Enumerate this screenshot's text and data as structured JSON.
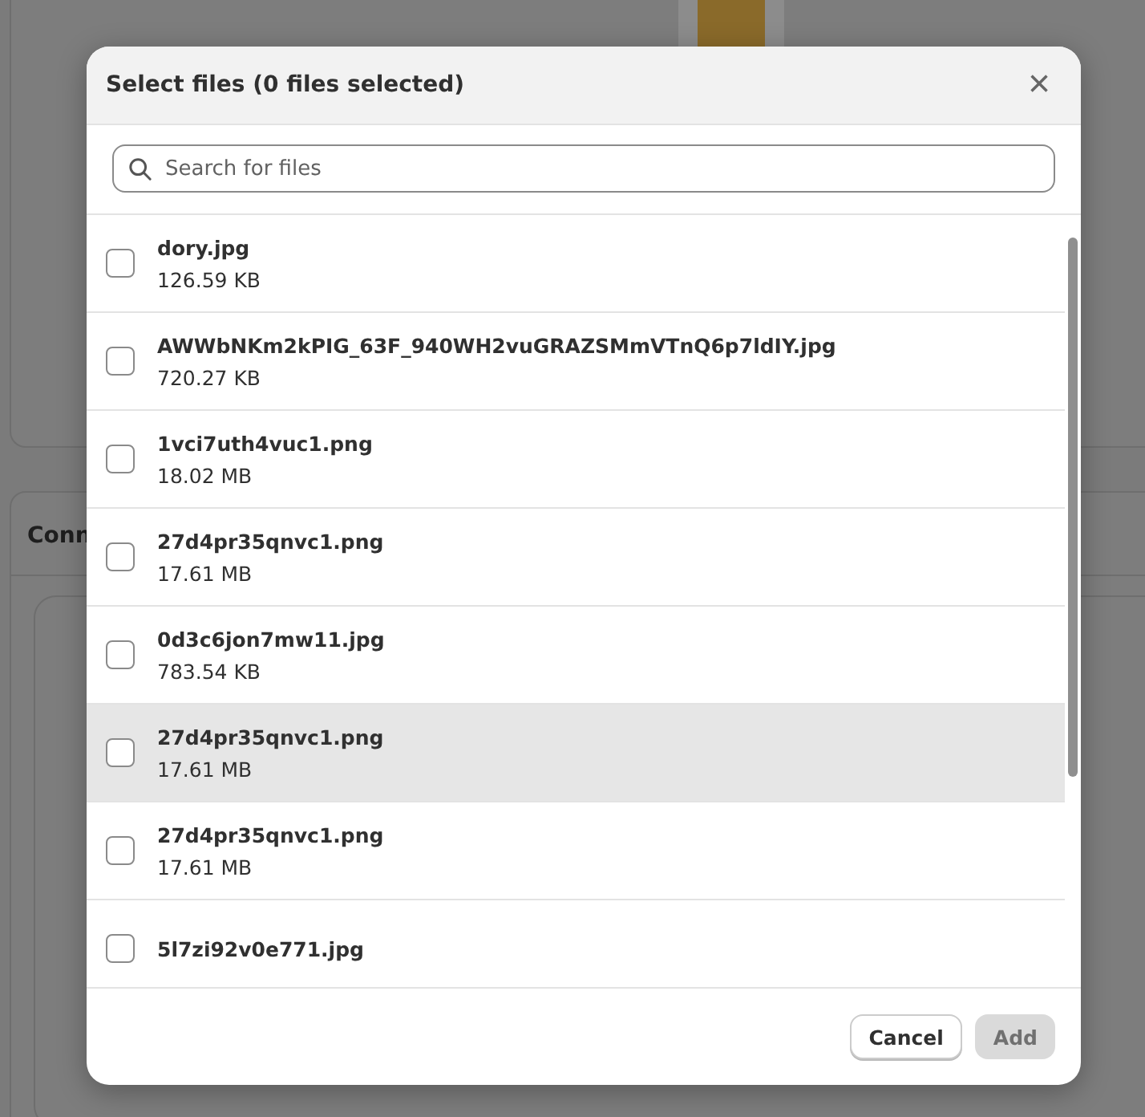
{
  "background": {
    "section_heading": "Conn"
  },
  "dialog": {
    "title": "Select files (0 files selected)",
    "close": "×",
    "search": {
      "placeholder": "Search for files"
    },
    "files": [
      {
        "name": "dory.jpg",
        "size": "126.59 KB",
        "checked": false,
        "highlighted": false
      },
      {
        "name": "AWWbNKm2kPIG_63F_940WH2vuGRAZSMmVTnQ6p7ldIY.jpg",
        "size": "720.27 KB",
        "checked": false,
        "highlighted": false
      },
      {
        "name": "1vci7uth4vuc1.png",
        "size": "18.02 MB",
        "checked": false,
        "highlighted": false
      },
      {
        "name": "27d4pr35qnvc1.png",
        "size": "17.61 MB",
        "checked": false,
        "highlighted": false
      },
      {
        "name": "0d3c6jon7mw11.jpg",
        "size": "783.54 KB",
        "checked": false,
        "highlighted": false
      },
      {
        "name": "27d4pr35qnvc1.png",
        "size": "17.61 MB",
        "checked": false,
        "highlighted": true
      },
      {
        "name": "27d4pr35qnvc1.png",
        "size": "17.61 MB",
        "checked": false,
        "highlighted": false
      },
      {
        "name": "5l7zi92v0e771.jpg",
        "checked": false,
        "highlighted": false
      }
    ],
    "buttons": [
      {
        "label": "Cancel",
        "kind": "secondary",
        "disabled": false
      },
      {
        "label": "Add",
        "kind": "primary",
        "disabled": true
      }
    ]
  }
}
